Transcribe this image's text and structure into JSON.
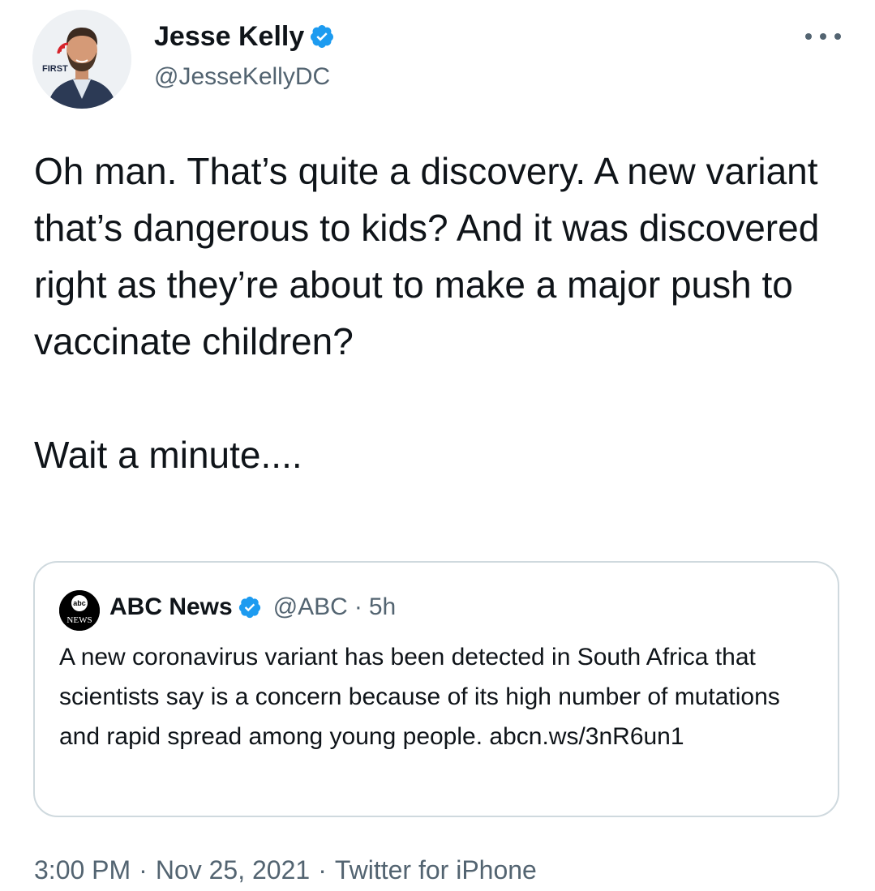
{
  "author": {
    "display_name": "Jesse Kelly",
    "handle": "@JesseKellyDC",
    "avatar_badge": "FIRST",
    "verified": true
  },
  "tweet": {
    "text": "Oh man. That’s quite a discovery. A new variant that’s dangerous to kids? And it was discovered right as they’re about to make a major push to vaccinate children?\n\nWait a minute....",
    "timestamp": "3:00 PM",
    "date": "Nov 25, 2021",
    "source": "Twitter for iPhone",
    "separator": "·"
  },
  "quoted_tweet": {
    "display_name": "ABC News",
    "handle": "@ABC",
    "separator": "·",
    "time": "5h",
    "verified": true,
    "avatar_text_top": "abc",
    "avatar_text_bottom": "NEWS",
    "text": "A new coronavirus variant has been detected in South Africa that scientists say is a concern because of its high number of mutations and rapid spread among young people. abcn.ws/3nR6un1"
  },
  "colors": {
    "text_primary": "#0f1419",
    "text_secondary": "#536471",
    "verified_blue": "#1d9bf0",
    "border": "#cfd9de"
  },
  "icons": {
    "verified": "verified-badge-icon",
    "more": "more-options-icon"
  }
}
